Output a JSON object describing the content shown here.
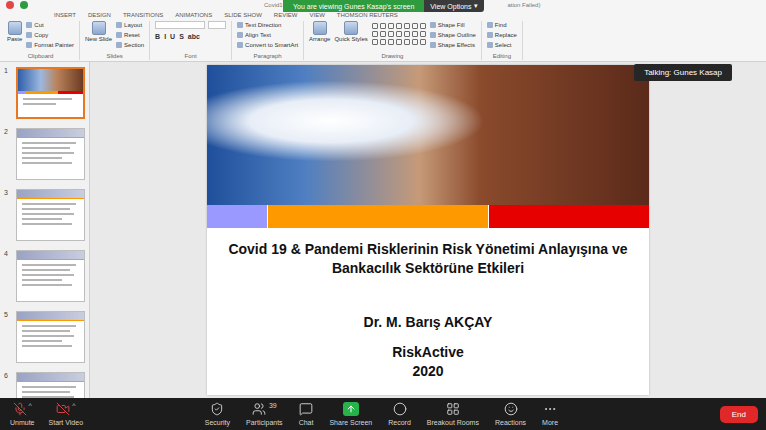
{
  "window": {
    "title_left": "Covid19 Pandemi",
    "title_right": "ation Failed)"
  },
  "zoom_banner": {
    "text": "You are viewing Gunes Kasap's screen",
    "button": "View Options",
    "caret": "▾"
  },
  "ribbon": {
    "tabs": [
      {
        "label": "INSERT",
        "selected": false
      },
      {
        "label": "DESIGN",
        "selected": false
      },
      {
        "label": "TRANSITIONS",
        "selected": false
      },
      {
        "label": "ANIMATIONS",
        "selected": false
      },
      {
        "label": "SLIDE SHOW",
        "selected": false
      },
      {
        "label": "REVIEW",
        "selected": false
      },
      {
        "label": "VIEW",
        "selected": false
      },
      {
        "label": "THOMSON REUTERS",
        "selected": false
      }
    ],
    "groups": [
      {
        "label": "Clipboard",
        "kind": "plain",
        "items": [
          {
            "label": "Paste",
            "kind": "large"
          },
          {
            "label": "Cut",
            "kind": "small"
          },
          {
            "label": "Copy",
            "kind": "small"
          },
          {
            "label": "Format Painter",
            "kind": "small"
          }
        ]
      },
      {
        "label": "Slides",
        "kind": "plain",
        "items": [
          {
            "label": "New Slide",
            "kind": "large"
          },
          {
            "label": "Layout",
            "kind": "small"
          },
          {
            "label": "Reset",
            "kind": "small"
          },
          {
            "label": "Section",
            "kind": "small"
          }
        ]
      },
      {
        "label": "Font",
        "kind": "font",
        "items": [
          {
            "label": "B",
            "kind": "format"
          },
          {
            "label": "I",
            "kind": "format"
          },
          {
            "label": "U",
            "kind": "format"
          },
          {
            "label": "S",
            "kind": "format"
          },
          {
            "label": "abc",
            "kind": "format"
          }
        ]
      },
      {
        "label": "Paragraph",
        "kind": "plain",
        "items": [
          {
            "label": "Text Direction",
            "kind": "small"
          },
          {
            "label": "Align Text",
            "kind": "small"
          },
          {
            "label": "Convert to SmartArt",
            "kind": "small"
          }
        ]
      },
      {
        "label": "Drawing",
        "kind": "drawing",
        "items": [
          {
            "label": "Arrange",
            "kind": "large"
          },
          {
            "label": "Quick Styles",
            "kind": "large"
          },
          {
            "label": "Shape Fill",
            "kind": "small"
          },
          {
            "label": "Shape Outline",
            "kind": "small"
          },
          {
            "label": "Shape Effects",
            "kind": "small"
          }
        ]
      },
      {
        "label": "Editing",
        "kind": "plain",
        "items": [
          {
            "label": "Find",
            "kind": "small"
          },
          {
            "label": "Replace",
            "kind": "small"
          },
          {
            "label": "Select",
            "kind": "small"
          }
        ]
      }
    ]
  },
  "slides": [
    {
      "number": "1",
      "selected": true,
      "kind": "title"
    },
    {
      "number": "2",
      "selected": false,
      "kind": "content"
    },
    {
      "number": "3",
      "selected": false,
      "kind": "content"
    },
    {
      "number": "4",
      "selected": false,
      "kind": "content"
    },
    {
      "number": "5",
      "selected": false,
      "kind": "content"
    },
    {
      "number": "6",
      "selected": false,
      "kind": "content"
    }
  ],
  "slide": {
    "title": "Covid 19 & Pandemi Risklerinin Risk Yönetimi Anlayışına ve Bankacılık Sektörüne Etkileri",
    "author": "Dr. M. Barış AKÇAY",
    "company": "RiskActive",
    "year": "2020",
    "bands": [
      {
        "color": "#9999ff"
      },
      {
        "color": "#ff9900"
      },
      {
        "color": "#e60000"
      }
    ]
  },
  "talking": {
    "label": "Talking: Gunes Kasap"
  },
  "toolbar": {
    "left": [
      {
        "label": "Unmute",
        "kind": "mic",
        "caret": "^"
      },
      {
        "label": "Start Video",
        "kind": "video",
        "caret": "^"
      }
    ],
    "center": [
      {
        "label": "Security",
        "kind": "security",
        "badge": ""
      },
      {
        "label": "Participants",
        "kind": "participants",
        "badge": "39"
      },
      {
        "label": "Chat",
        "kind": "chat",
        "badge": ""
      },
      {
        "label": "Share Screen",
        "kind": "share",
        "badge": ""
      },
      {
        "label": "Record",
        "kind": "record",
        "badge": ""
      },
      {
        "label": "Breakout Rooms",
        "kind": "breakout",
        "badge": ""
      },
      {
        "label": "Reactions",
        "kind": "reactions",
        "badge": ""
      },
      {
        "label": "More",
        "kind": "more",
        "badge": ""
      }
    ],
    "end": "End"
  }
}
